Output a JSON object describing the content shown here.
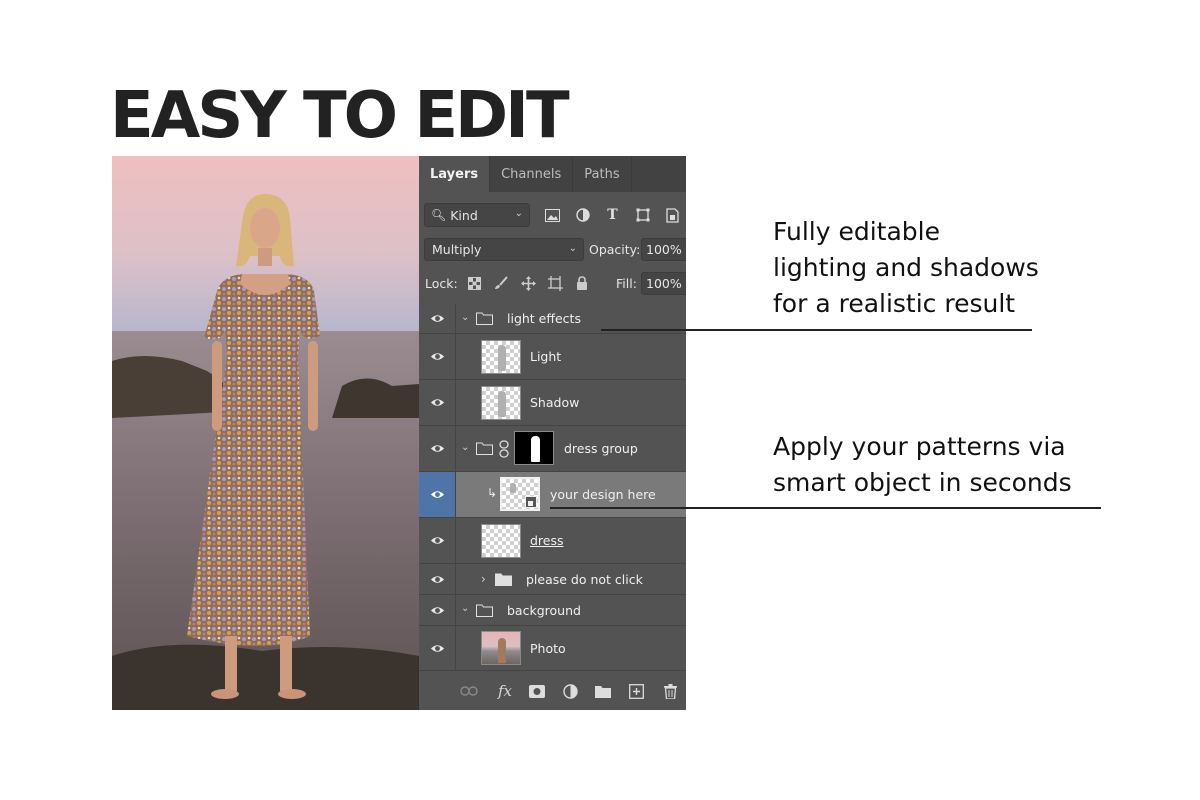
{
  "headline": "EASY TO EDIT",
  "panel": {
    "tabs": [
      {
        "label": "Layers",
        "active": true
      },
      {
        "label": "Channels",
        "active": false
      },
      {
        "label": "Paths",
        "active": false
      }
    ],
    "filter_label": "Kind",
    "blend_mode": "Multiply",
    "opacity_label": "Opacity:",
    "opacity_value": "100%",
    "lock_label": "Lock:",
    "fill_label": "Fill:",
    "fill_value": "100%",
    "layers": [
      {
        "name": "light effects",
        "kind": "group",
        "expanded": true
      },
      {
        "name": "Light",
        "kind": "layer"
      },
      {
        "name": "Shadow",
        "kind": "layer"
      },
      {
        "name": "dress group",
        "kind": "group-mask",
        "expanded": true
      },
      {
        "name": "your design here",
        "kind": "smart-object",
        "selected": true
      },
      {
        "name": "dress",
        "kind": "layer"
      },
      {
        "name": "please do not click",
        "kind": "group",
        "expanded": false
      },
      {
        "name": "background",
        "kind": "group",
        "expanded": true
      },
      {
        "name": "Photo",
        "kind": "photo"
      }
    ],
    "selected_color": "#4e74a8"
  },
  "callouts": {
    "lighting": [
      "Fully editable",
      "lighting and shadows",
      "for a realistic result"
    ],
    "patterns": [
      "Apply your patterns via",
      "smart object in seconds"
    ]
  },
  "colors": {
    "headline": "#222222",
    "panel_bg": "#535353",
    "tab_bar_bg": "#424242"
  }
}
